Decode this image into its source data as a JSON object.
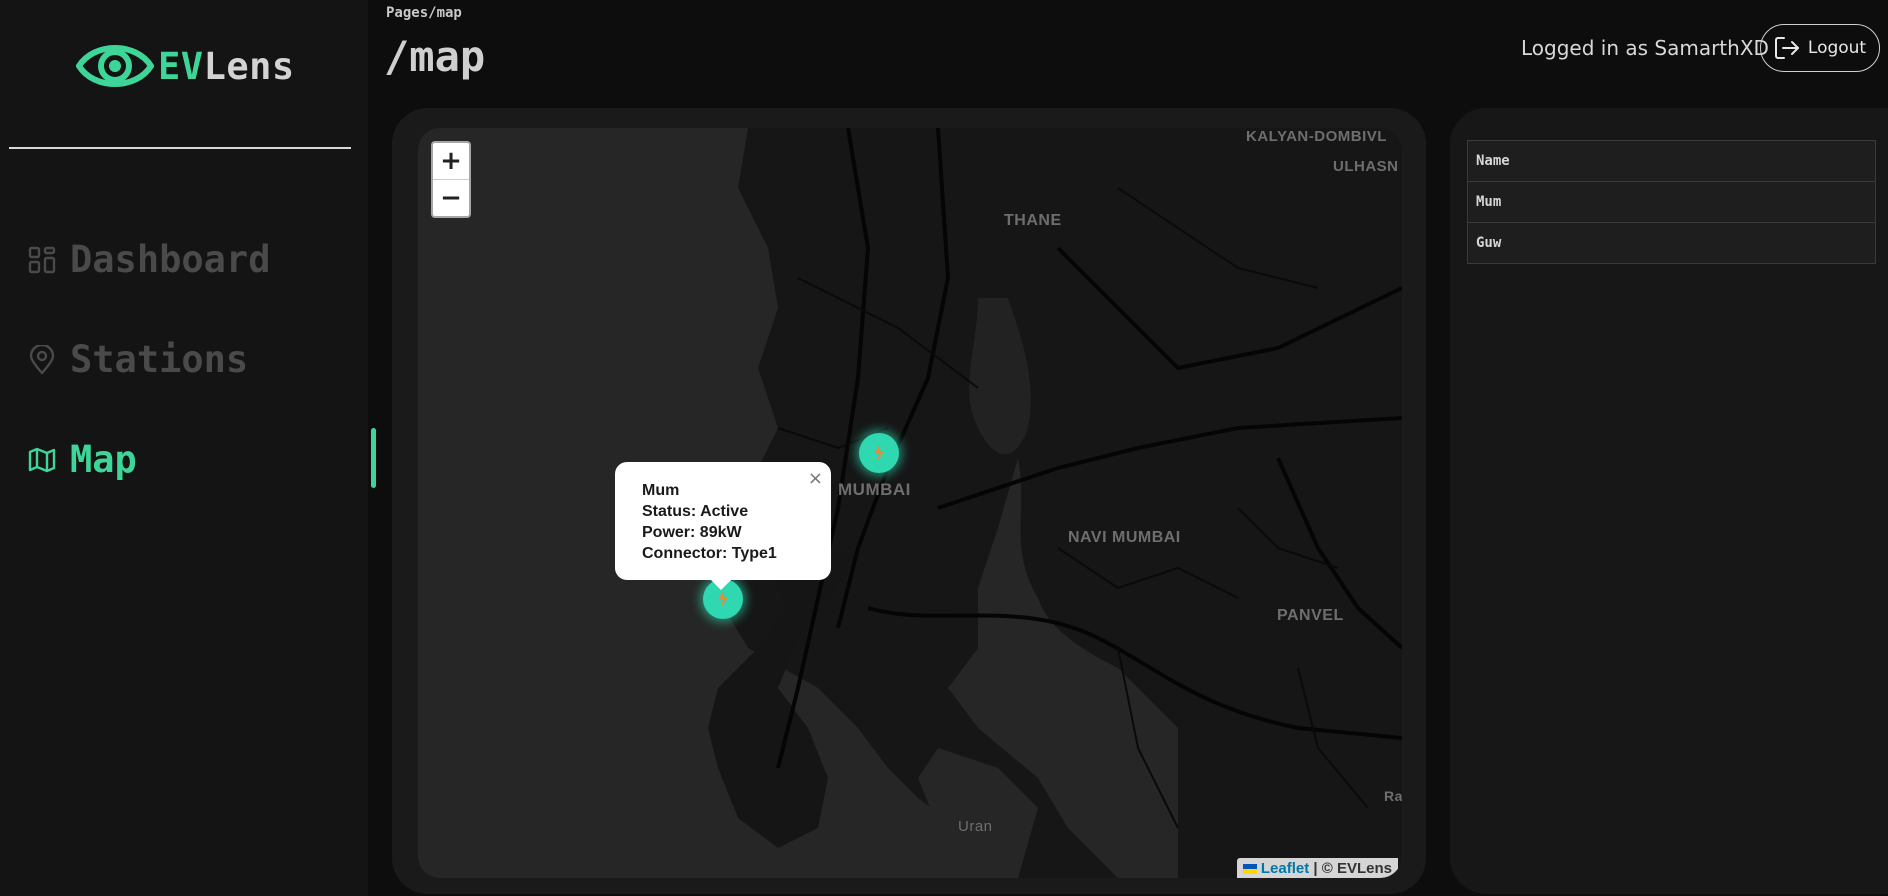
{
  "app": {
    "logo_ev": "EV",
    "logo_lens": "Lens"
  },
  "sidebar": {
    "items": [
      {
        "label": "Dashboard",
        "icon": "dashboard-grid-icon",
        "active": false
      },
      {
        "label": "Stations",
        "icon": "map-pin-icon",
        "active": false
      },
      {
        "label": "Map",
        "icon": "folded-map-icon",
        "active": true
      }
    ]
  },
  "header": {
    "breadcrumb": "Pages/map",
    "title": "/map",
    "login_text": "Logged in as SamarthXD",
    "logout_label": "Logout"
  },
  "map": {
    "zoom_in": "+",
    "zoom_out": "−",
    "labels": {
      "kalyan": "KALYAN-DOMBIVL",
      "ulhas": "ULHASN",
      "thane": "THANE",
      "mumbai": "MUMBAI",
      "navi_mumbai": "NAVI MUMBAI",
      "panvel": "PANVEL",
      "uran": "Uran",
      "ra": "Ra"
    },
    "popup": {
      "name": "Mum",
      "status": "Status: Active",
      "power": "Power: 89kW",
      "connector": "Connector: Type1",
      "close": "×"
    },
    "attribution": {
      "leaflet": "Leaflet",
      "rest": "| © EVLens"
    },
    "colors": {
      "marker": "#2fd8b0",
      "accent": "#3ed598"
    }
  },
  "stations_table": {
    "header": "Name",
    "rows": [
      "Mum",
      "Guw"
    ]
  }
}
